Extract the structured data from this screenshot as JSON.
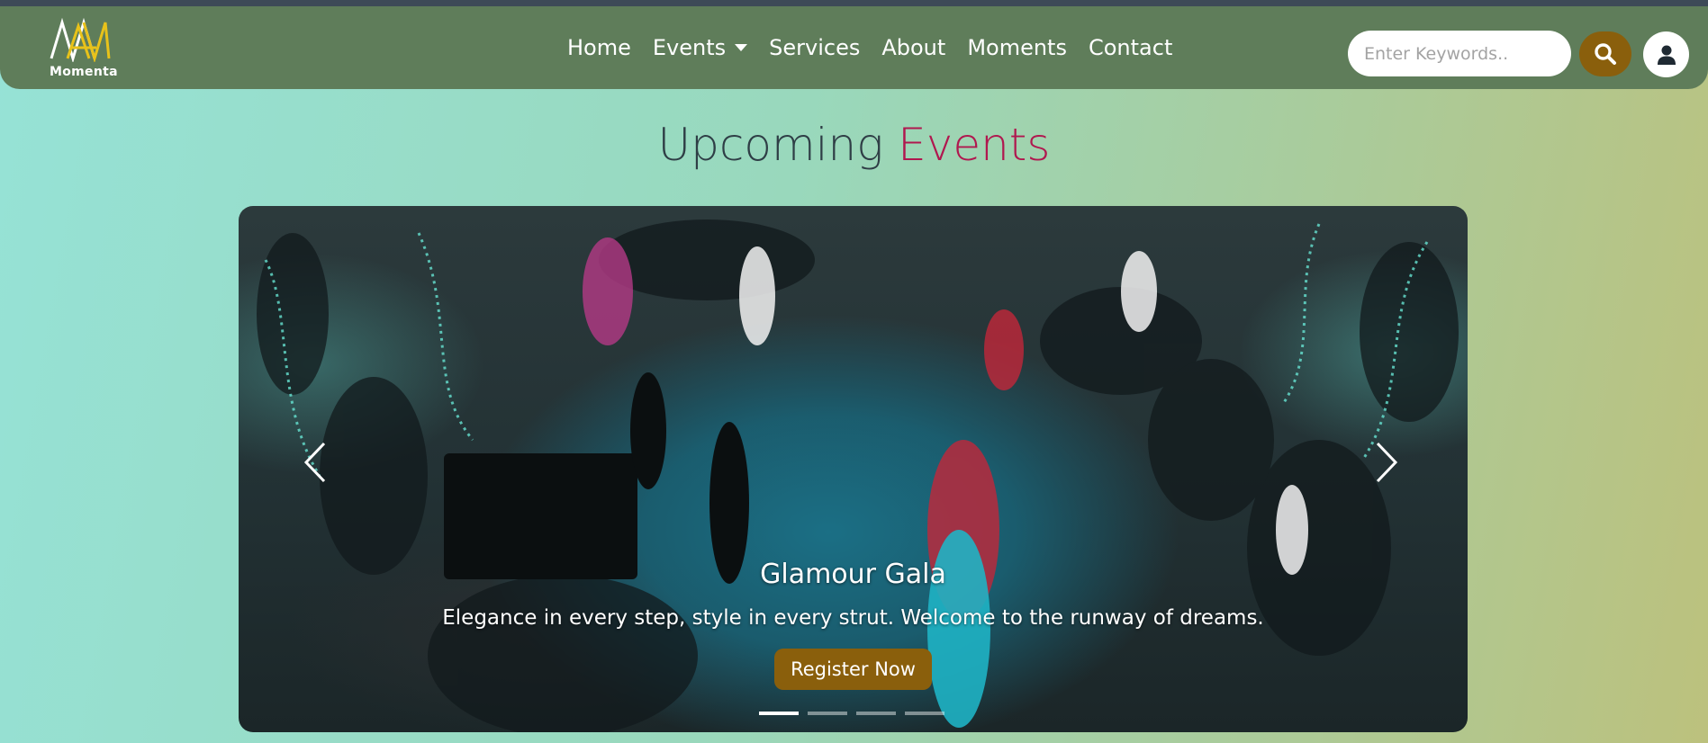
{
  "brand": {
    "name": "Momenta",
    "icon": "momenta-logo"
  },
  "nav": {
    "items": [
      {
        "label": "Home"
      },
      {
        "label": "Events",
        "dropdown": true
      },
      {
        "label": "Services"
      },
      {
        "label": "About"
      },
      {
        "label": "Moments"
      },
      {
        "label": "Contact"
      }
    ]
  },
  "search": {
    "placeholder": "Enter Keywords..",
    "value": "",
    "icon": "search-icon"
  },
  "user": {
    "icon": "user-icon"
  },
  "heading": {
    "part1": "Upcoming",
    "part2": "Events"
  },
  "carousel": {
    "slide": {
      "title": "Glamour Gala",
      "description": "Elegance in every step, style in every strut. Welcome to the runway of dreams.",
      "button": "Register Now"
    },
    "indicator_count": 4,
    "active_index": 0
  },
  "colors": {
    "navbar": "#5f7d5a",
    "accent_button": "#8a5f0c",
    "title_highlight": "#b0184f",
    "title_dark": "#2f3e46"
  }
}
